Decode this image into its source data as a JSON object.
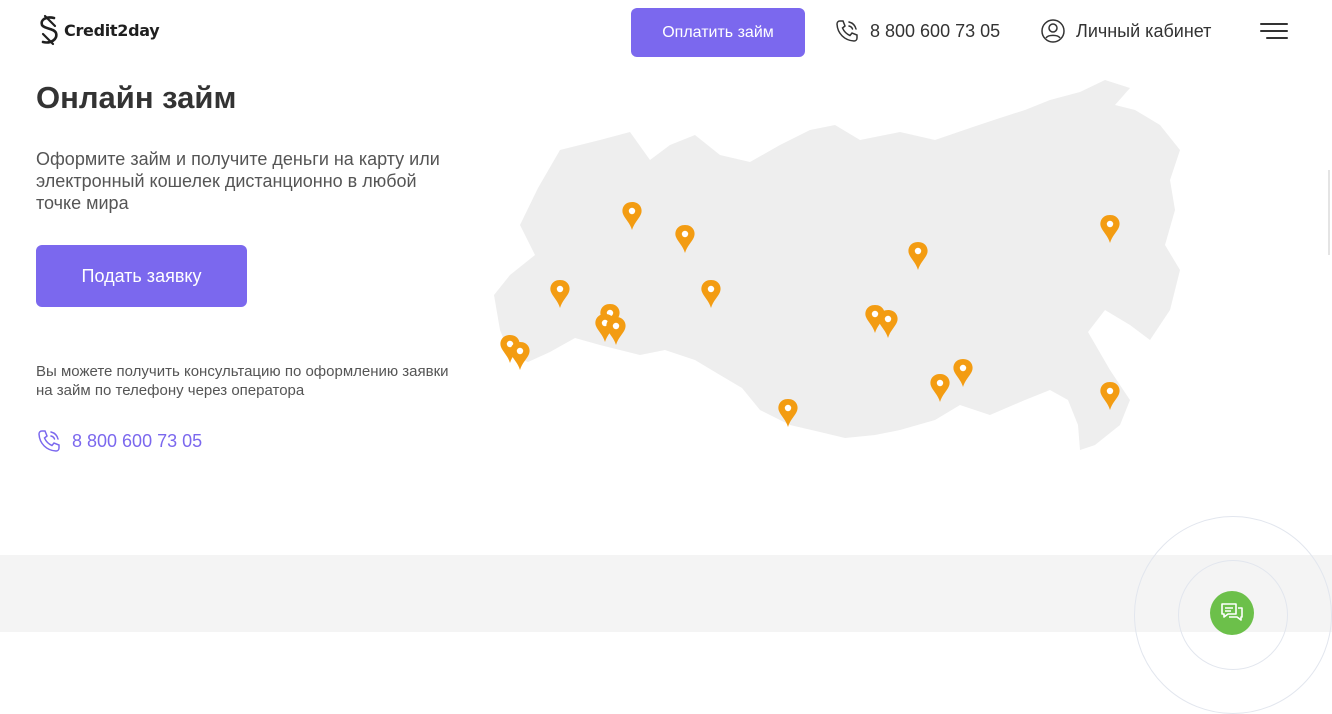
{
  "header": {
    "logo_text": "Credit2day",
    "pay_button": "Оплатить займ",
    "phone": "8 800 600 73 05",
    "cabinet": "Личный кабинет"
  },
  "hero": {
    "title": "Онлайн займ",
    "subtitle": "Оформите займ и получите деньги на карту или электронный кошелек дистанционно в любой точке мира",
    "apply_button": "Подать заявку",
    "consultation": "Вы можете получить консультацию по оформлению заявки на займ по телефону через оператора",
    "phone": "8 800 600 73 05"
  },
  "colors": {
    "accent": "#7b68ee",
    "pin": "#f39c12",
    "map_fill": "#eeeeee",
    "chat": "#6cc04a"
  },
  "icons": {
    "phone": "phone-icon",
    "user": "user-circle-icon",
    "menu": "hamburger-icon",
    "chat": "chat-icon",
    "pin": "map-pin-icon"
  }
}
